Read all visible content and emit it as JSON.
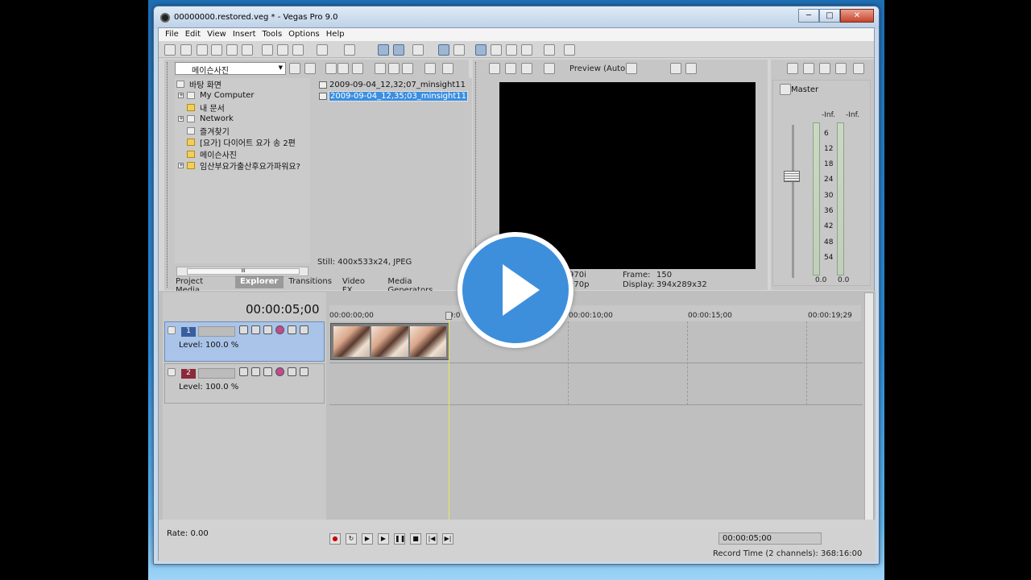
{
  "window": {
    "title": "00000000.restored.veg * - Vegas Pro 9.0",
    "controls": {
      "minimize": "─",
      "maximize": "□",
      "close": "✕"
    }
  },
  "menu": [
    "File",
    "Edit",
    "View",
    "Insert",
    "Tools",
    "Options",
    "Help"
  ],
  "explorer": {
    "location": "메이슨사진",
    "tree": [
      {
        "label": "바탕 화면",
        "icon": "desktop-icon",
        "expandable": false
      },
      {
        "label": "My Computer",
        "icon": "computer-icon",
        "expandable": true
      },
      {
        "label": "내 문서",
        "icon": "folder-icon",
        "expandable": false
      },
      {
        "label": "Network",
        "icon": "network-icon",
        "expandable": true
      },
      {
        "label": "즐겨찾기",
        "icon": "favorites-icon",
        "expandable": false
      },
      {
        "label": "[요가] 다이어트 요가 송 2편",
        "icon": "folder-icon",
        "expandable": false
      },
      {
        "label": "메이슨사진",
        "icon": "folder-icon",
        "expandable": false
      },
      {
        "label": "임산부요가출산후요가파워요?",
        "icon": "folder-icon",
        "expandable": true
      }
    ],
    "files": [
      {
        "name": "2009-09-04_12,32;07_minsight11",
        "selected": false
      },
      {
        "name": "2009-09-04_12,35;03_minsight11",
        "selected": true
      }
    ],
    "file_info": "Still: 400x533x24, JPEG",
    "scroll_thumb": "III",
    "tabs": [
      {
        "label": "Project Media",
        "active": false
      },
      {
        "label": "Explorer",
        "active": true
      },
      {
        "label": "Transitions",
        "active": false
      },
      {
        "label": "Video FX",
        "active": false
      },
      {
        "label": "Media Generators",
        "active": false
      }
    ]
  },
  "preview": {
    "mode": "Preview (Auto)",
    "left_info_1": "970i",
    "left_info_2": "970p",
    "frame_label": "Frame:",
    "frame_value": "150",
    "display_label": "Display:",
    "display_value": "394x289x32"
  },
  "mixer": {
    "label": "Master",
    "inf_left": "-Inf.",
    "inf_right": "-Inf.",
    "ticks": [
      "6",
      "12",
      "18",
      "24",
      "30",
      "36",
      "42",
      "48",
      "54"
    ],
    "value_left": "0.0",
    "value_right": "0.0"
  },
  "timeline": {
    "timecode": "00:00:05;00",
    "ruler": [
      "00:00:00;00",
      "0:0",
      "00:00:10;00",
      "00:00:15;00",
      "00:00:19;29"
    ],
    "ruler_marker": "+5",
    "tracks": [
      {
        "number": "1",
        "level": "Level: 100.0 %",
        "color": "#3a5f9e"
      },
      {
        "number": "2",
        "level": "Level: 100.0 %",
        "color": "#8a2a3a"
      }
    ],
    "clip_frames": 3
  },
  "bottom": {
    "rate": "Rate: 0.00",
    "timecode": "00:00:05;00",
    "status": "Record Time (2 channels): 368:16:00"
  },
  "overlay": {
    "icon": "play-icon"
  }
}
